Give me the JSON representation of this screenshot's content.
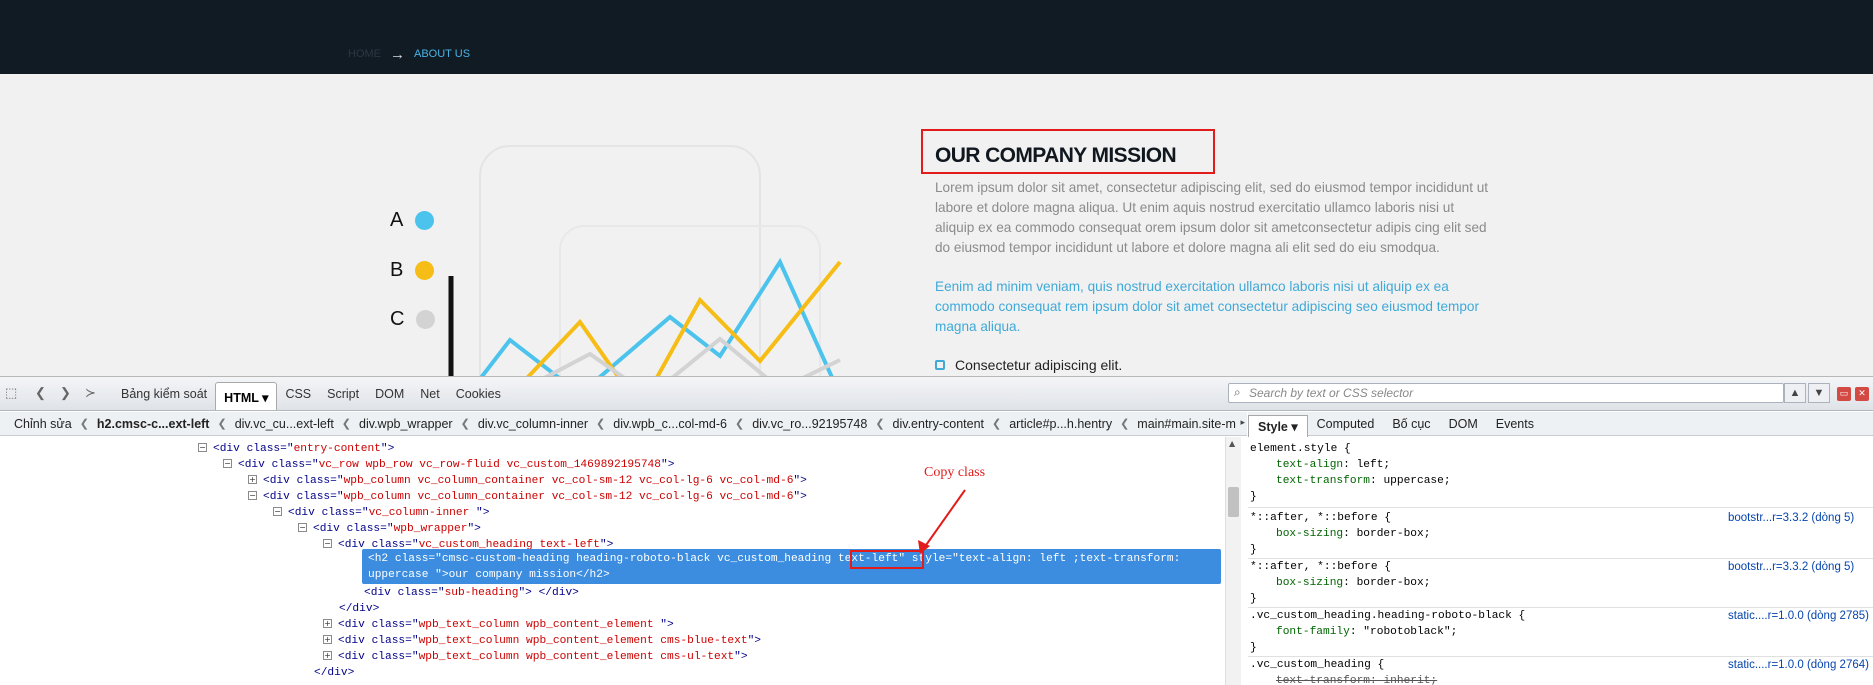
{
  "breadcrumb": {
    "home": "HOME",
    "separator": "→",
    "current": "ABOUT US"
  },
  "chart_legend": [
    {
      "label": "A",
      "color": "#4cc3ec"
    },
    {
      "label": "B",
      "color": "#f6bd16"
    },
    {
      "label": "C",
      "color": "#d3d3d3"
    }
  ],
  "section": {
    "title": "OUR COMPANY MISSION",
    "paragraph_gray": "Lorem ipsum dolor sit amet, consectetur adipiscing elit, sed do eiusmod tempor incididunt ut labore et dolore magna aliqua. Ut enim aquis nostrud exercitatio ullamco laboris nisi ut aliquip ex ea commodo consequat orem ipsum dolor sit ametconsectetur adipis cing elit sed do eiusmod tempor incididunt ut labore et dolore magna ali elit sed do eiu smodqua.",
    "paragraph_blue": "Eenim ad minim veniam, quis nostrud exercitation ullamco laboris nisi ut aliquip ex ea commodo consequat rem ipsum dolor sit amet consectetur adipiscing seo eiusmod tempor magna aliqua.",
    "list_item": "Consectetur adipiscing elit."
  },
  "colors": {
    "header_bg": "#111b24",
    "accent_blue": "#49b3e6",
    "highlight_red": "#e21b1b",
    "selection_blue": "#3c8de0"
  },
  "firebug": {
    "tabs": [
      "Bảng kiểm soát",
      "HTML",
      "CSS",
      "Script",
      "DOM",
      "Net",
      "Cookies"
    ],
    "active_tab": "HTML",
    "search_placeholder": "Search by text or CSS selector",
    "edit_label": "Chỉnh sửa",
    "crumbs": [
      "h2.cmsc-c...ext-left",
      "div.vc_cu...ext-left",
      "div.wpb_wrapper",
      "div.vc_column-inner",
      "div.wpb_c...col-md-6",
      "div.vc_ro...92195748",
      "div.entry-content",
      "article#p...h.hentry",
      "main#main.site-m"
    ],
    "side_tabs": [
      "Style",
      "Computed",
      "Bố cục",
      "DOM",
      "Events"
    ],
    "annotation": "Copy class"
  },
  "html_tree": {
    "line1": {
      "tag": "div",
      "attr": "class",
      "val": "entry-content"
    },
    "line2": {
      "tag": "div",
      "attr": "class",
      "val": "vc_row wpb_row vc_row-fluid vc_custom_1469892195748"
    },
    "line3": {
      "tag": "div",
      "attr": "class",
      "val": "wpb_column vc_column_container vc_col-sm-12 vc_col-lg-6 vc_col-md-6"
    },
    "line4": {
      "tag": "div",
      "attr": "class",
      "val": "wpb_column vc_column_container vc_col-sm-12 vc_col-lg-6 vc_col-md-6"
    },
    "line5": {
      "tag": "div",
      "attr": "class",
      "val": "vc_column-inner "
    },
    "line6": {
      "tag": "div",
      "attr": "class",
      "val": "wpb_wrapper"
    },
    "line7": {
      "tag": "div",
      "attr": "class",
      "val": "vc_custom_heading text-left"
    },
    "selected_line1": "<h2 class=\"cmsc-custom-heading heading-roboto-black vc_custom_heading text-left\" style=\"text-align: left ;text-transform:",
    "selected_line2": "uppercase \">our company mission</h2>",
    "line9": {
      "tag": "div",
      "attr": "class",
      "val": "sub-heading"
    },
    "line10": "</div>",
    "line11": {
      "tag": "div",
      "attr": "class",
      "val": "wpb_text_column wpb_content_element "
    },
    "line12": {
      "tag": "div",
      "attr": "class",
      "val": "wpb_text_column wpb_content_element cms-blue-text"
    },
    "line13": {
      "tag": "div",
      "attr": "class",
      "val": "wpb_text_column wpb_content_element cms-ul-text"
    },
    "line14": "</div>"
  },
  "css_rules": {
    "r1_selector": "element.style {",
    "r1_p1": "text-align",
    "r1_v1": "left;",
    "r1_p2": "text-transform",
    "r1_v2": "uppercase;",
    "r2_selector": "*::after, *::before {",
    "r2_source": "bootstr...r=3.3.2 (dòng 5)",
    "r2_p1": "box-sizing",
    "r2_v1": "border-box;",
    "r3_selector": "*::after, *::before {",
    "r3_source": "bootstr...r=3.3.2 (dòng 5)",
    "r3_p1": "box-sizing",
    "r3_v1": "border-box;",
    "r4_selector": ".vc_custom_heading.heading-roboto-black {",
    "r4_source": "static....r=1.0.0 (dòng 2785)",
    "r4_p1": "font-family",
    "r4_v1": "\"robotoblack\";",
    "r5_selector": ".vc_custom_heading {",
    "r5_source": "static....r=1.0.0 (dòng 2764)",
    "r5_p1": "text-transform",
    "r5_v1": "inherit;",
    "close": "}"
  }
}
